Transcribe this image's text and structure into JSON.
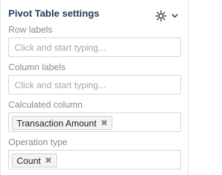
{
  "panel": {
    "title": "Pivot Table settings",
    "icons": {
      "settings": "gear-icon",
      "dropdown": "chevron-down-icon"
    }
  },
  "row_labels": {
    "label": "Row labels",
    "placeholder": "Click and start typing..."
  },
  "column_labels": {
    "label": "Column labels",
    "placeholder": "Click and start typing..."
  },
  "calculated_column": {
    "label": "Calculated column",
    "chip": "Transaction Amount",
    "remove_glyph": "✖"
  },
  "operation_type": {
    "label": "Operation type",
    "chip": "Count",
    "remove_glyph": "✖"
  },
  "colors": {
    "title": "#213a5c",
    "label": "#8a8a8a",
    "border": "#d4d4d4",
    "chip_bg": "#f4f4f4"
  }
}
